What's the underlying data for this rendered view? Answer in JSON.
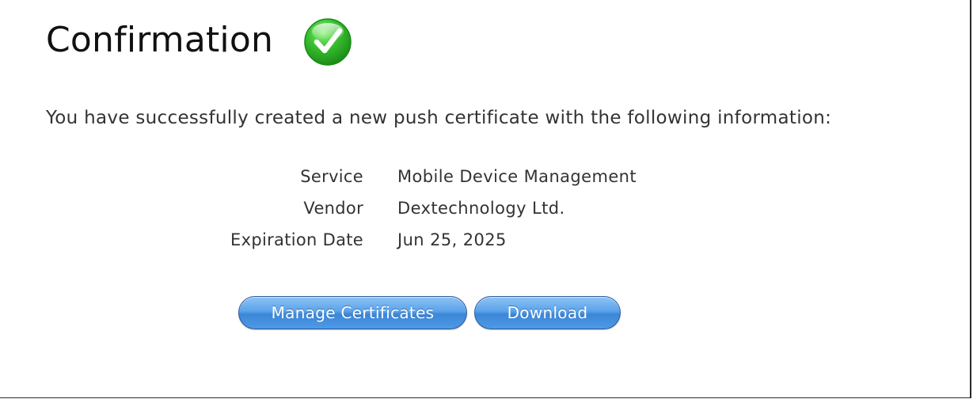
{
  "header": {
    "title": "Confirmation",
    "status_icon": "check-circle-icon",
    "status_color": "#2db52a"
  },
  "message": {
    "intro": "You have successfully created a new push certificate with the following information:"
  },
  "details": [
    {
      "label": "Service",
      "value": "Mobile Device Management"
    },
    {
      "label": "Vendor",
      "value": "Dextechnology Ltd."
    },
    {
      "label": "Expiration Date",
      "value": "Jun 25, 2025"
    }
  ],
  "actions": {
    "manage_label": "Manage Certificates",
    "download_label": "Download",
    "button_color": "#4a95e3"
  }
}
